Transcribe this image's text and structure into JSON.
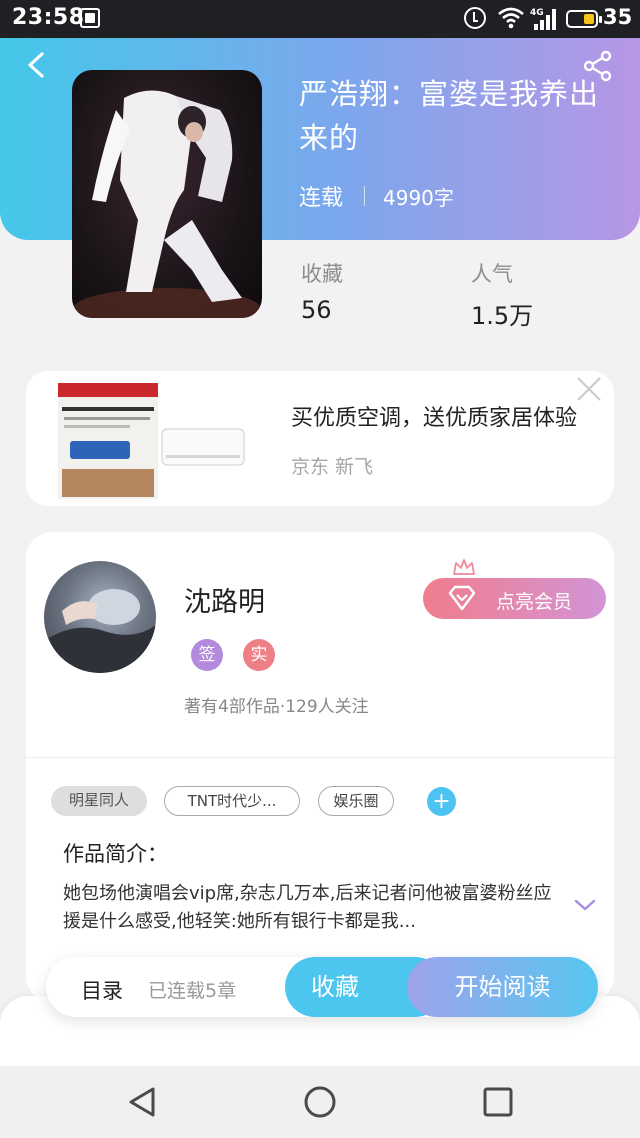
{
  "status_bar": {
    "time": "23:58",
    "battery_pct": "35",
    "network_type": "4G",
    "icons": [
      "notification-icon",
      "alarm-icon",
      "wifi-icon",
      "signal-icon",
      "battery-icon"
    ]
  },
  "book": {
    "title": "严浩翔：富婆是我养出来的",
    "status": "连载",
    "word_count": "4990字",
    "favorites_label": "收藏",
    "favorites_value": "56",
    "popularity_label": "人气",
    "popularity_value": "1.5万"
  },
  "ad": {
    "title": "买优质空调，送优质家居体验",
    "source": "京东 新飞"
  },
  "author": {
    "name": "沈路明",
    "badge_sign": "签",
    "badge_real": "实",
    "meta": "著有4部作品·129人关注",
    "vip_button": "点亮会员"
  },
  "tags": [
    "明星同人",
    "TNT时代少...",
    "娱乐圈"
  ],
  "intro": {
    "label": "作品简介：",
    "text": "她包场他演唱会vip席,杂志几万本,后来记者问他被富婆粉丝应援是什么感受,他轻笑:她所有银行卡都是我..."
  },
  "actions": {
    "toc": "目录",
    "toc_status": "已连载5章",
    "favorite": "收藏",
    "start_reading": "开始阅读"
  },
  "colors": {
    "header_start": "#44c8ea",
    "header_end": "#b697e6",
    "accent_blue": "#4cc6ee",
    "badge_purple": "#b48bdc",
    "badge_red": "#ee7f86",
    "vip_start": "#f07d8c",
    "vip_end": "#d394d6"
  }
}
